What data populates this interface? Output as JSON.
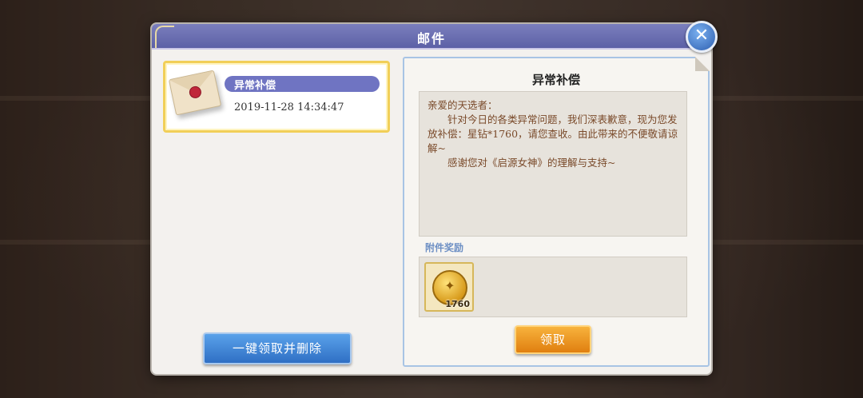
{
  "dialog": {
    "title": "邮件",
    "close_icon": "close-icon"
  },
  "mail_list": {
    "items": [
      {
        "name": "异常补偿",
        "time": "2019-11-28  14:34:47",
        "icon": "envelope-icon"
      }
    ],
    "collect_all_label": "一键领取并删除"
  },
  "mail_detail": {
    "title": "异常补偿",
    "body": [
      "亲爱的天选者：",
      "　　针对今日的各类异常问题，我们深表歉意，现为您发放补偿：星钻*1760，请您查收。由此带来的不便敬请谅解~",
      "　　感谢您对《启源女神》的理解与支持~"
    ],
    "attachments_label": "附件奖励",
    "attachments": [
      {
        "item": "星钻",
        "icon": "coin-icon",
        "quantity": "1760"
      }
    ],
    "claim_label": "领取"
  },
  "colors": {
    "title_bar": "#6b6fb5",
    "accent_orange": "#e88a1a",
    "accent_blue": "#3f82d6",
    "selection_border": "#f1cf58",
    "body_text": "#7a4a2a"
  }
}
